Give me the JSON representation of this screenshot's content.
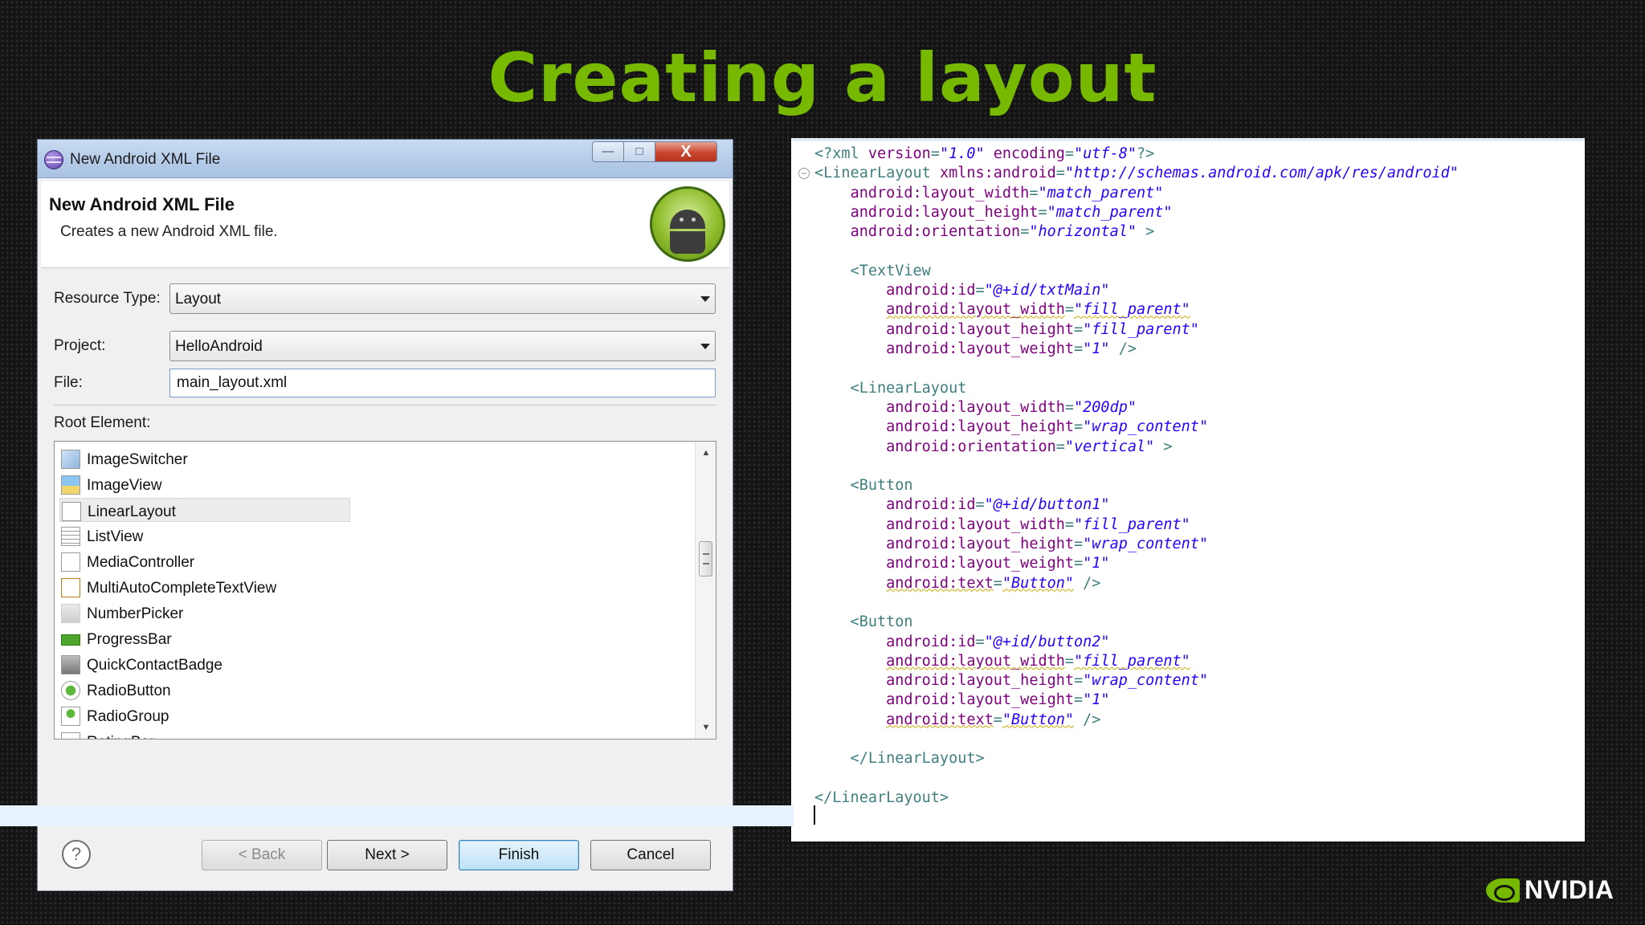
{
  "slide": {
    "title": "Creating a layout"
  },
  "dialog": {
    "window_title": "New Android XML File",
    "header_title": "New Android XML File",
    "header_description": "Creates a new Android XML file.",
    "window_buttons": {
      "minimize": "—",
      "maximize": "□",
      "close": "X"
    },
    "resource_type": {
      "label": "Resource Type:",
      "value": "Layout"
    },
    "project": {
      "label": "Project:",
      "value": "HelloAndroid"
    },
    "file": {
      "label": "File:",
      "value": "main_layout.xml"
    },
    "root_element": {
      "label": "Root Element:",
      "selected": "LinearLayout",
      "items": [
        {
          "label": "ImageSwitcher",
          "icon": "image-switcher-icon"
        },
        {
          "label": "ImageView",
          "icon": "image-view-icon"
        },
        {
          "label": "LinearLayout",
          "icon": "linear-layout-icon"
        },
        {
          "label": "ListView",
          "icon": "list-view-icon"
        },
        {
          "label": "MediaController",
          "icon": "media-controller-icon"
        },
        {
          "label": "MultiAutoCompleteTextView",
          "icon": "multi-autocomplete-icon"
        },
        {
          "label": "NumberPicker",
          "icon": "number-picker-icon"
        },
        {
          "label": "ProgressBar",
          "icon": "progress-bar-icon"
        },
        {
          "label": "QuickContactBadge",
          "icon": "quick-contact-badge-icon"
        },
        {
          "label": "RadioButton",
          "icon": "radio-button-icon"
        },
        {
          "label": "RadioGroup",
          "icon": "radio-group-icon"
        },
        {
          "label": "RatingBar",
          "icon": "rating-bar-icon"
        }
      ]
    },
    "buttons": {
      "back": "< Back",
      "next": "Next >",
      "finish": "Finish",
      "cancel": "Cancel",
      "help": "?"
    }
  },
  "code": {
    "lines": [
      "<?xml version=\"1.0\" encoding=\"utf-8\"?>",
      "<LinearLayout xmlns:android=\"http://schemas.android.com/apk/res/android\"",
      "    android:layout_width=\"match_parent\"",
      "    android:layout_height=\"match_parent\"",
      "    android:orientation=\"horizontal\" >",
      "",
      "    <TextView",
      "        android:id=\"@+id/txtMain\"",
      "        android:layout_width=\"fill_parent\"",
      "        android:layout_height=\"fill_parent\"",
      "        android:layout_weight=\"1\" />",
      "",
      "    <LinearLayout",
      "        android:layout_width=\"200dp\"",
      "        android:layout_height=\"wrap_content\"",
      "        android:orientation=\"vertical\" >",
      "",
      "    <Button",
      "        android:id=\"@+id/button1\"",
      "        android:layout_width=\"fill_parent\"",
      "        android:layout_height=\"wrap_content\"",
      "        android:layout_weight=\"1\"",
      "        android:text=\"Button\" />",
      "",
      "    <Button",
      "        android:id=\"@+id/button2\"",
      "        android:layout_width=\"fill_parent\"",
      "        android:layout_height=\"wrap_content\"",
      "        android:layout_weight=\"1\"",
      "        android:text=\"Button\" />",
      "",
      "    </LinearLayout>",
      "",
      "</LinearLayout>"
    ],
    "warning_lines": [
      8,
      22,
      26,
      29
    ]
  },
  "brand": {
    "name": "NVIDIA",
    "accent_color": "#76b900"
  }
}
